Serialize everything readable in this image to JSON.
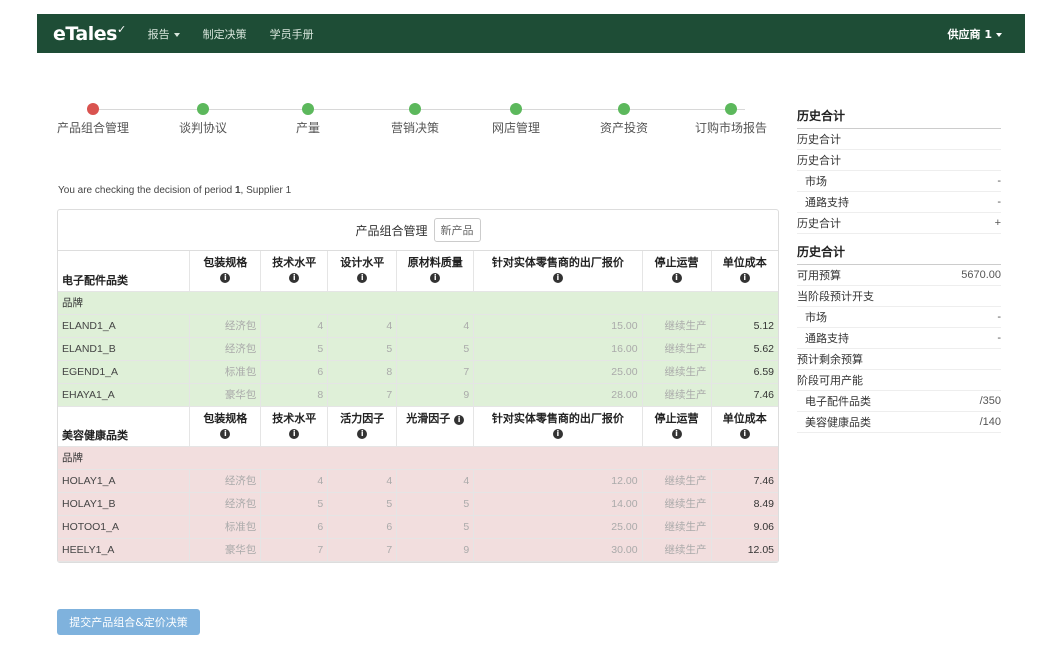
{
  "nav": {
    "brand": "eTales",
    "items": [
      {
        "label": "报告",
        "caret": true
      },
      {
        "label": "制定决策",
        "caret": false
      },
      {
        "label": "学员手册",
        "caret": false
      }
    ],
    "user": "供应商 1"
  },
  "stepper": {
    "steps": [
      {
        "label": "产品组合管理",
        "status": "current",
        "color": "#d9534f"
      },
      {
        "label": "谈判协议",
        "status": "done",
        "color": "#5cb85c"
      },
      {
        "label": "产量",
        "status": "done",
        "color": "#5cb85c"
      },
      {
        "label": "营销决策",
        "status": "done",
        "color": "#5cb85c"
      },
      {
        "label": "网店管理",
        "status": "done",
        "color": "#5cb85c"
      },
      {
        "label": "资产投资",
        "status": "done",
        "color": "#5cb85c"
      },
      {
        "label": "订购市场报告",
        "status": "done",
        "color": "#5cb85c"
      }
    ]
  },
  "period_info": {
    "prefix": "You are checking the decision of period ",
    "period": "1",
    "suffix": ", Supplier 1"
  },
  "panel": {
    "title": "产品组合管理",
    "new_button": "新产品"
  },
  "electronics": {
    "headers": [
      "电子配件品类",
      "包装规格",
      "技术水平",
      "设计水平",
      "原材料质量",
      "针对实体零售商的出厂报价",
      "停止运营",
      "单位成本"
    ],
    "section_label": "品牌",
    "rows": [
      [
        "ELAND1_A",
        "经济包",
        "4",
        "4",
        "4",
        "15.00",
        "继续生产",
        "5.12"
      ],
      [
        "ELAND1_B",
        "经济包",
        "5",
        "5",
        "5",
        "16.00",
        "继续生产",
        "5.62"
      ],
      [
        "EGEND1_A",
        "标准包",
        "6",
        "8",
        "7",
        "25.00",
        "继续生产",
        "6.59"
      ],
      [
        "EHAYA1_A",
        "豪华包",
        "8",
        "7",
        "9",
        "28.00",
        "继续生产",
        "7.46"
      ]
    ]
  },
  "beauty": {
    "headers": [
      "美容健康品类",
      "包装规格",
      "技术水平",
      "活力因子",
      "光滑因子",
      "针对实体零售商的出厂报价",
      "停止运营",
      "单位成本"
    ],
    "section_label": "品牌",
    "rows": [
      [
        "HOLAY1_A",
        "经济包",
        "4",
        "4",
        "4",
        "12.00",
        "继续生产",
        "7.46"
      ],
      [
        "HOLAY1_B",
        "经济包",
        "5",
        "5",
        "5",
        "14.00",
        "继续生产",
        "8.49"
      ],
      [
        "HOTOO1_A",
        "标准包",
        "6",
        "6",
        "5",
        "25.00",
        "继续生产",
        "9.06"
      ],
      [
        "HEELY1_A",
        "豪华包",
        "7",
        "7",
        "9",
        "30.00",
        "继续生产",
        "12.05"
      ]
    ]
  },
  "submit_button": "提交产品组合&定价决策",
  "sidebar": {
    "section1_title": "历史合计",
    "section1_rows": [
      {
        "label": "历史合计",
        "value": "",
        "indent": false
      },
      {
        "label": "历史合计",
        "value": "",
        "indent": false
      },
      {
        "label": "市场",
        "value": "-",
        "indent": true
      },
      {
        "label": "通路支持",
        "value": "-",
        "indent": true
      },
      {
        "label": "历史合计",
        "value": "+",
        "indent": false
      }
    ],
    "section2_title": "历史合计",
    "section2_rows": [
      {
        "label": "可用预算",
        "value": "5670.00",
        "indent": false
      },
      {
        "label": "当阶段预计开支",
        "value": "",
        "indent": false
      },
      {
        "label": "市场",
        "value": "-",
        "indent": true
      },
      {
        "label": "通路支持",
        "value": "-",
        "indent": true
      },
      {
        "label": "预计剩余预算",
        "value": "",
        "indent": false
      },
      {
        "label": "阶段可用产能",
        "value": "",
        "indent": false
      },
      {
        "label": "电子配件品类",
        "value": "/350",
        "indent": true
      },
      {
        "label": "美容健康品类",
        "value": "/140",
        "indent": true
      }
    ]
  }
}
